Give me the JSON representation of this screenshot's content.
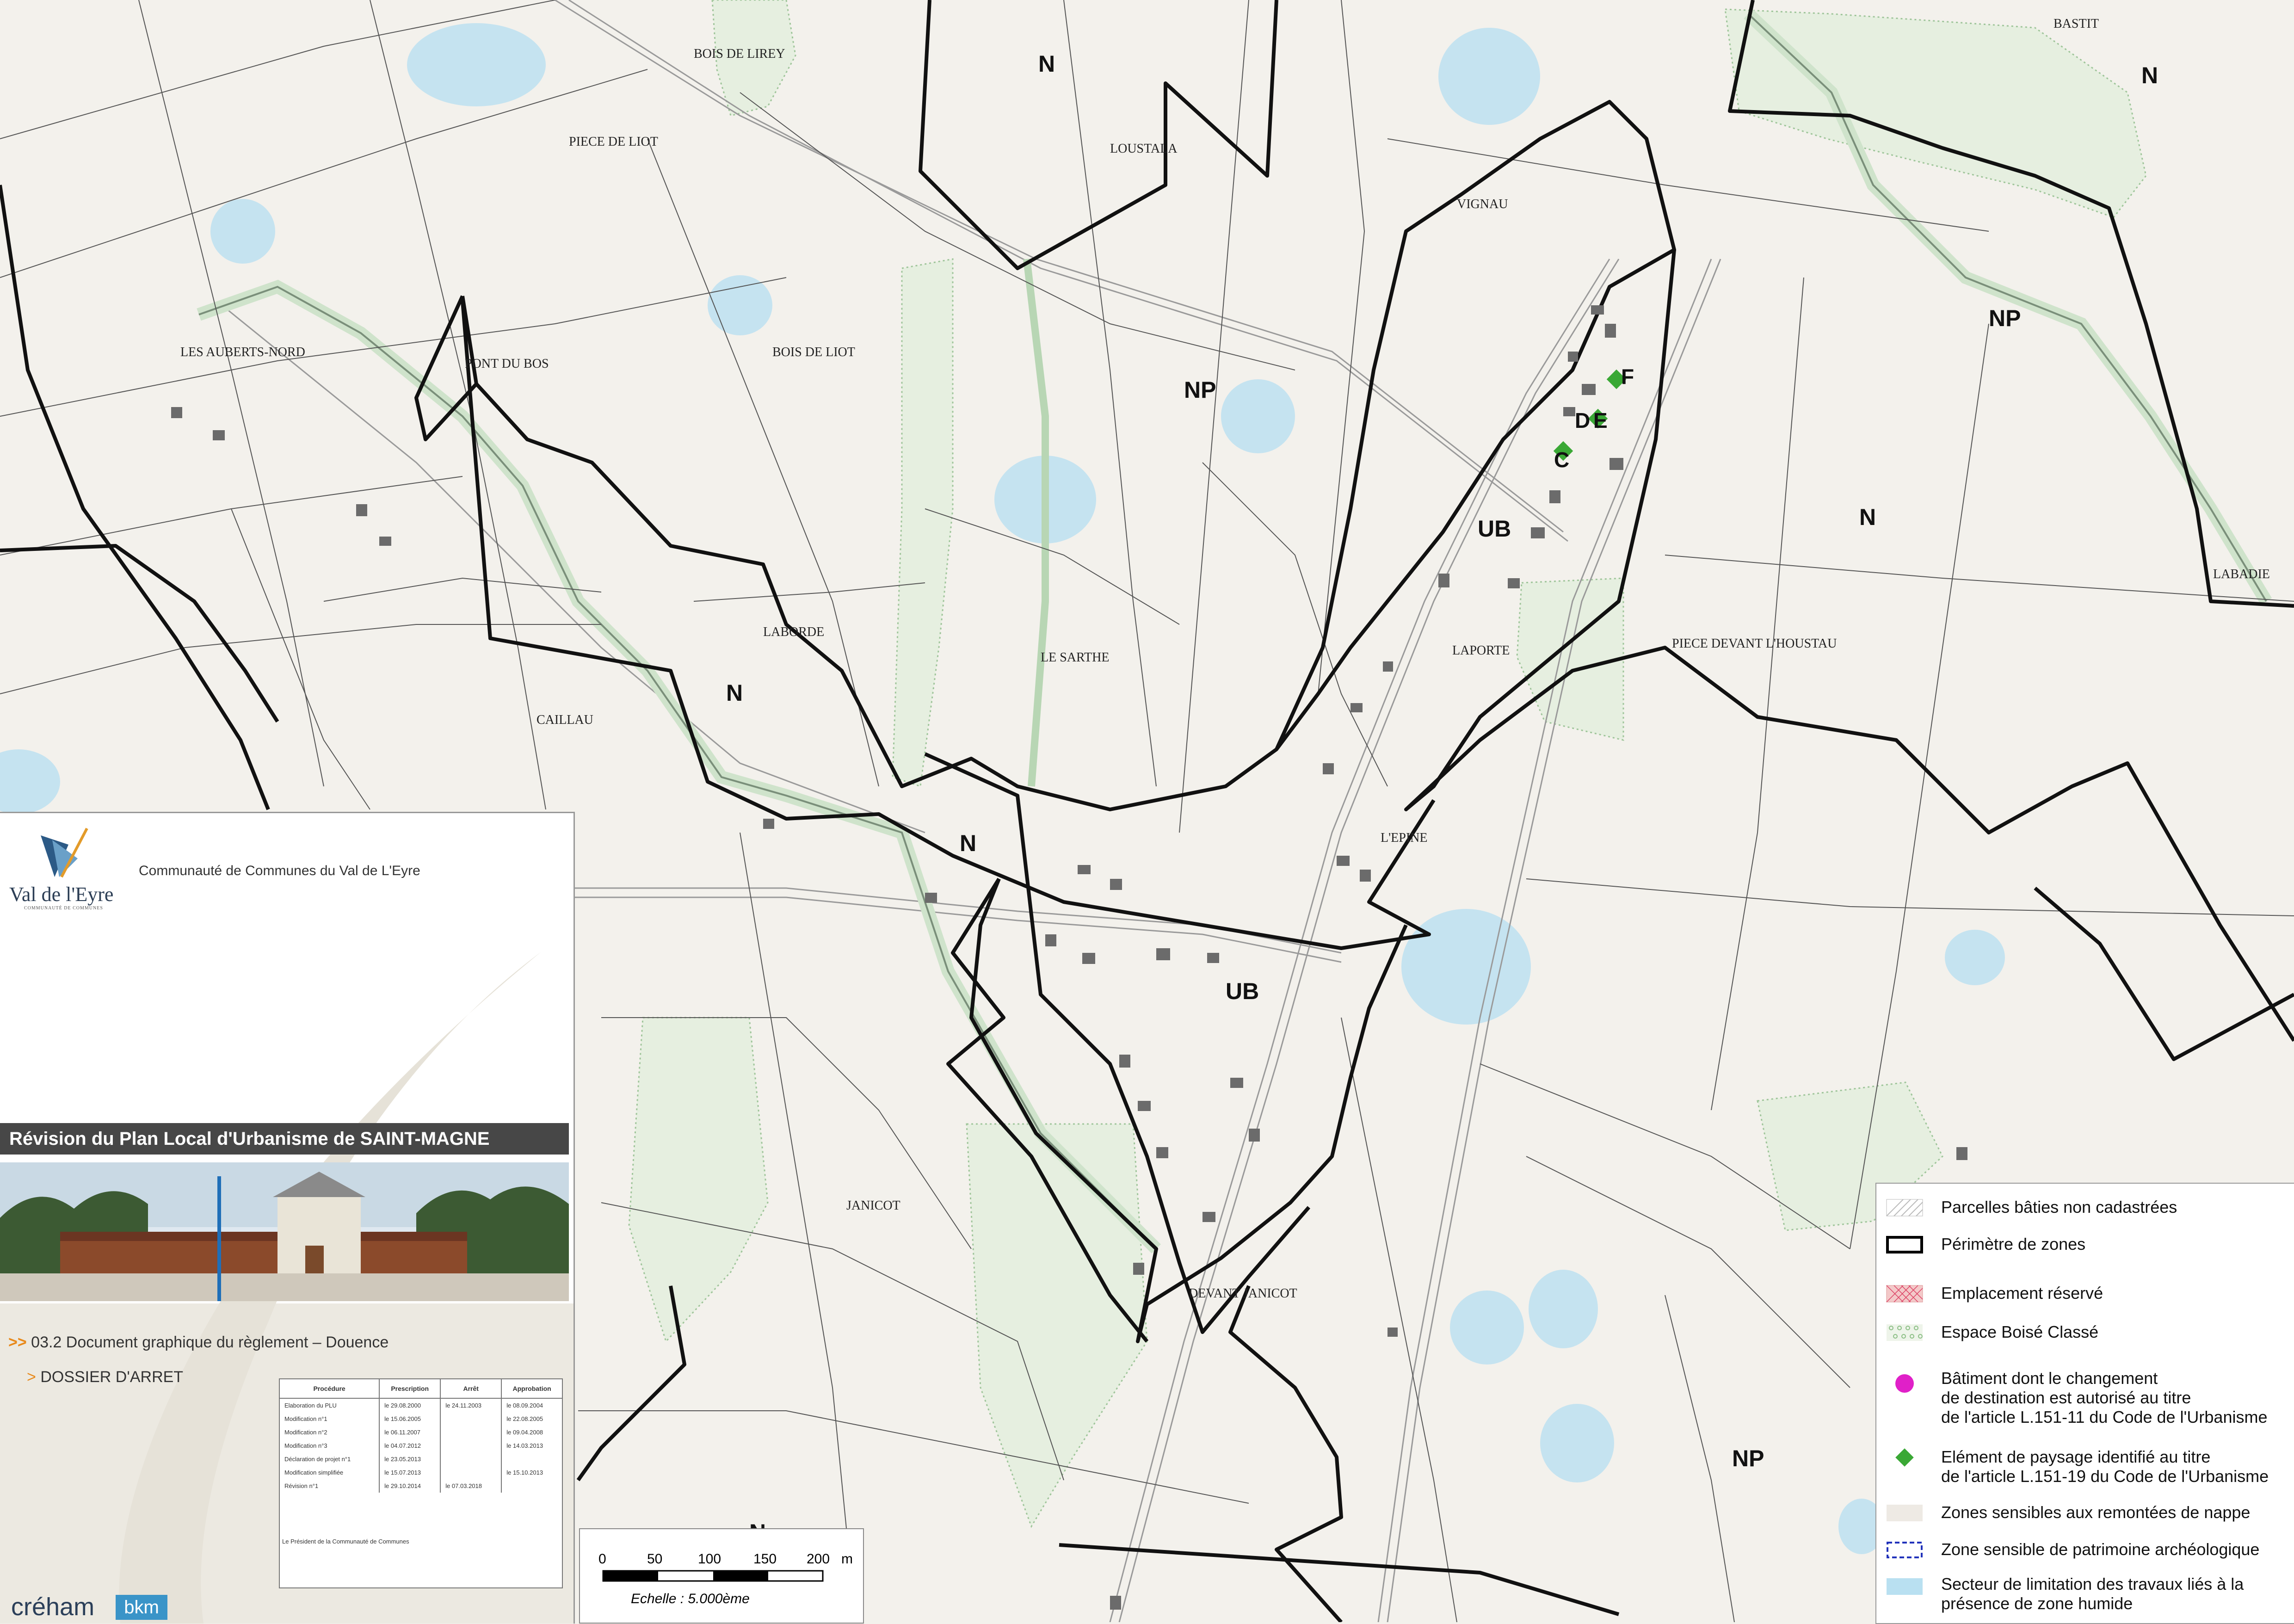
{
  "map": {
    "zones": [
      {
        "id": "N-top-center",
        "label": "N"
      },
      {
        "id": "N-top-right",
        "label": "N"
      },
      {
        "id": "NP-right",
        "label": "NP"
      },
      {
        "id": "NP-center",
        "label": "NP"
      },
      {
        "id": "N-right",
        "label": "N"
      },
      {
        "id": "UB-north",
        "label": "UB"
      },
      {
        "id": "N-laborde",
        "label": "N"
      },
      {
        "id": "N-center",
        "label": "N"
      },
      {
        "id": "UB-south",
        "label": "UB"
      },
      {
        "id": "NP-bottom",
        "label": "NP"
      },
      {
        "id": "N-bottom",
        "label": "N"
      }
    ],
    "place_names": [
      "BASTIT",
      "BOIS DE LIREY",
      "PIECE DE LIOT",
      "LOUSTALA",
      "VIGNAU",
      "LES AUBERTS-NORD",
      "PONT DU BOS",
      "BOIS DE LIOT",
      "LABORDE",
      "LE SARTHE",
      "LAPORTE",
      "PIECE DEVANT L'HOUSTAU",
      "LABADIE",
      "CAILLAU",
      "L'EPINE",
      "JANICOT",
      "DEVANT JANICOT"
    ],
    "heritage_letters": [
      "F",
      "D",
      "E",
      "C"
    ]
  },
  "cartouche": {
    "logo_text": "Val de l'Eyre",
    "logo_subtext": "COMMUNAUTÉ DE COMMUNES",
    "community_name": "Communauté de Communes du Val de L'Eyre",
    "title": "Révision du Plan Local d'Urbanisme de SAINT-MAGNE",
    "doc_prefix": ">> ",
    "doc_label": "03.2 Document graphique du règlement – Douence",
    "dossier_prefix": "> ",
    "dossier_label": "DOSSIER D'ARRET",
    "table": {
      "headers": [
        "Procédure",
        "Prescription",
        "Arrêt",
        "Approbation"
      ],
      "rows": [
        [
          "Elaboration du PLU",
          "le 29.08.2000",
          "le 24.11.2003",
          "le 08.09.2004"
        ],
        [
          "Modification n°1",
          "le 15.06.2005",
          "",
          "le 22.08.2005"
        ],
        [
          "Modification n°2",
          "le 06.11.2007",
          "",
          "le 09.04.2008"
        ],
        [
          "Modification n°3",
          "le 04.07.2012",
          "",
          "le 14.03.2013"
        ],
        [
          "Déclaration de projet n°1",
          "le 23.05.2013",
          "",
          ""
        ],
        [
          "Modification simplifiée",
          "le 15.07.2013",
          "",
          "le 15.10.2013"
        ],
        [
          "Révision n°1",
          "le 29.10.2014",
          "le 07.03.2018",
          ""
        ]
      ]
    },
    "president": "Le Président de la Communauté de Communes",
    "credit_1": "créham",
    "credit_2": "bkm"
  },
  "scale": {
    "ticks": [
      "0",
      "50",
      "100",
      "150",
      "200"
    ],
    "unit": "m",
    "label": "Echelle : 5.000ème"
  },
  "legend": {
    "items": [
      {
        "key": "parcelles",
        "label": "Parcelles bâties non cadastrées"
      },
      {
        "key": "perimetre",
        "label": "Périmètre de zones"
      },
      {
        "key": "emplacement",
        "label": "Emplacement réservé"
      },
      {
        "key": "ebc",
        "label": "Espace Boisé Classé"
      },
      {
        "key": "batiment",
        "label": "Bâtiment dont le changement\nde destination est autorisé au titre\nde l'article L.151-11 du Code de l'Urbanisme",
        "color": "#e020c8"
      },
      {
        "key": "paysage",
        "label": "Elément de paysage identifié au titre\nde l'article L.151-19 du Code de l'Urbanisme",
        "color": "#3aa835"
      },
      {
        "key": "nappe",
        "label": "Zones sensibles aux remontées de nappe"
      },
      {
        "key": "archeo",
        "label": "Zone sensible de patrimoine archéologique",
        "color": "#2233bb"
      },
      {
        "key": "humide",
        "label": "Secteur de limitation des travaux liés à la\nprésence de zone humide",
        "color": "#b9e0f1"
      }
    ]
  },
  "colors": {
    "background": "#f3f1ec",
    "zone_border": "#111111",
    "ebc": "#9fc59a",
    "wetland": "#b9e0f1",
    "accent_orange": "#e8891a",
    "title_bar": "#474747"
  }
}
